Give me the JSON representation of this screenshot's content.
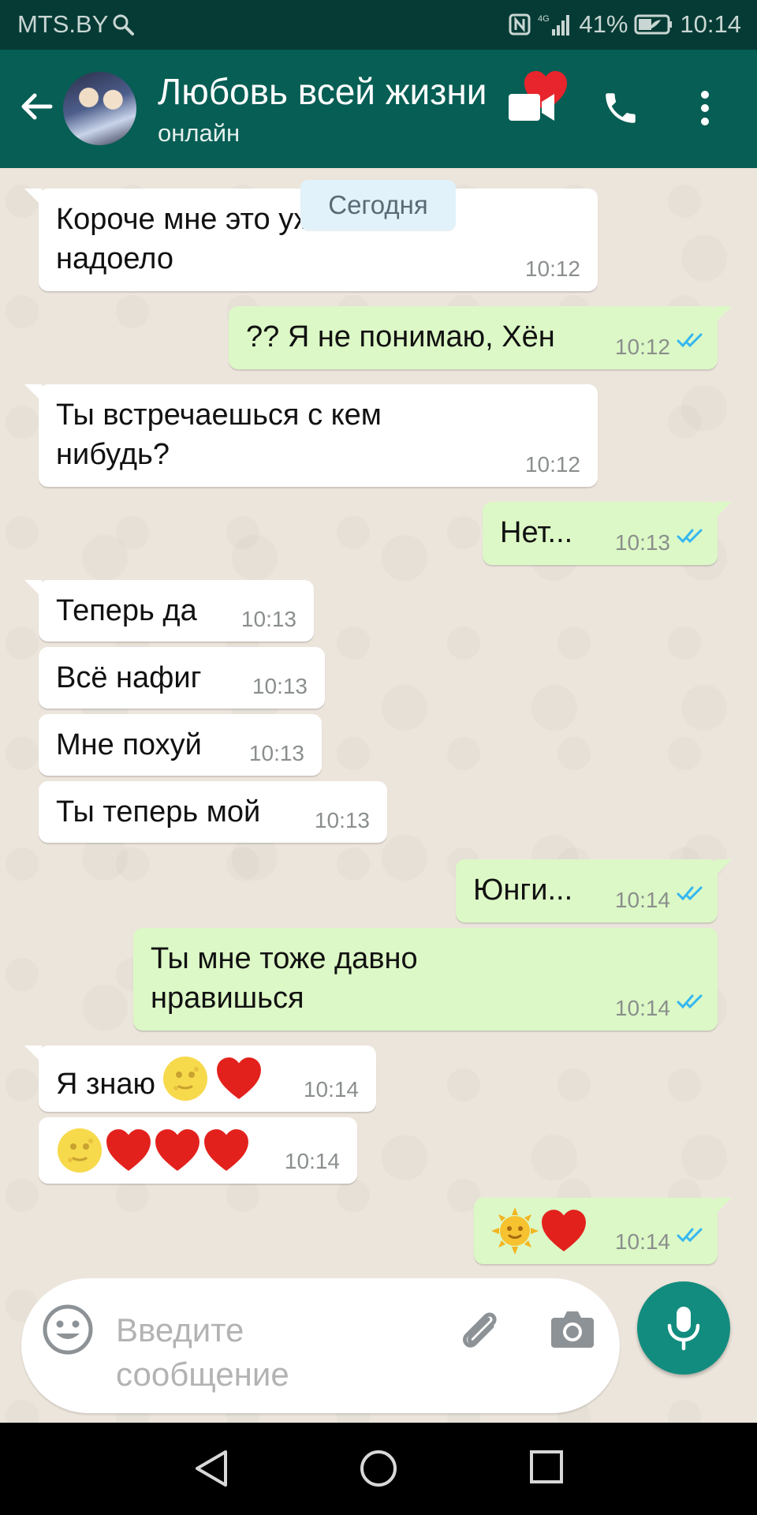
{
  "status_bar": {
    "carrier": "MTS.BY",
    "network": "4G",
    "battery": "41%",
    "time": "10:14"
  },
  "header": {
    "contact_name": "Любовь всей жизни",
    "contact_status": "онлайн",
    "avatar_icon": "avatar-photo",
    "name_suffix_emoji": "heart"
  },
  "chat": {
    "date_chip": "Сегодня",
    "messages": [
      {
        "dir": "in",
        "lines": [
          "Короче мне это уже",
          "надоело"
        ],
        "time": "10:12"
      },
      {
        "dir": "out",
        "text": "?? Я не понимаю, Хён",
        "time": "10:12",
        "read": true
      },
      {
        "dir": "in",
        "lines": [
          "Ты встречаешься с кем",
          "нибудь?"
        ],
        "time": "10:12"
      },
      {
        "dir": "out",
        "text": "Нет...",
        "time": "10:13",
        "read": true
      },
      {
        "dir": "in",
        "text": "Теперь да",
        "time": "10:13"
      },
      {
        "dir": "in",
        "text": "Всё нафиг",
        "time": "10:13"
      },
      {
        "dir": "in",
        "text": "Мне похуй",
        "time": "10:13"
      },
      {
        "dir": "in",
        "text": "Ты теперь мой",
        "time": "10:13"
      },
      {
        "dir": "out",
        "text": "Юнги...",
        "time": "10:14",
        "read": true
      },
      {
        "dir": "out",
        "lines": [
          "Ты мне тоже давно",
          "нравишься"
        ],
        "time": "10:14",
        "read": true
      },
      {
        "dir": "in",
        "text": "Я знаю",
        "emoji": [
          "moon-face",
          "heart"
        ],
        "time": "10:14"
      },
      {
        "dir": "in",
        "text": "",
        "emoji": [
          "moon-face",
          "heart",
          "heart",
          "heart"
        ],
        "time": "10:14"
      },
      {
        "dir": "out",
        "text": "",
        "emoji": [
          "sun-face",
          "heart"
        ],
        "time": "10:14",
        "read": true
      }
    ]
  },
  "composer": {
    "placeholder_line1": "Введите",
    "placeholder_line2": "сообщение"
  },
  "colors": {
    "status_bar": "#063b35",
    "app_bar": "#075e54",
    "incoming_bubble": "#ffffff",
    "outgoing_bubble": "#dcf8c6",
    "read_ticks": "#34b7f1",
    "mic_button": "#128c7e"
  }
}
